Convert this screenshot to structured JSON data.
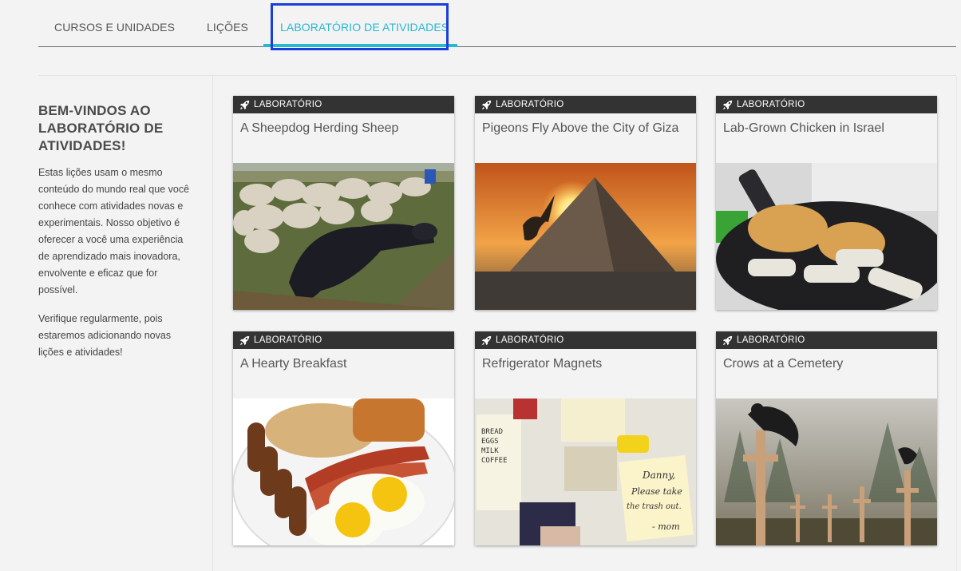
{
  "tabs": [
    {
      "label": "CURSOS E UNIDADES"
    },
    {
      "label": "LIÇÕES"
    },
    {
      "label": "LABORATÓRIO DE ATIVIDADES"
    }
  ],
  "sidebar": {
    "title": "BEM-VINDOS AO LABORATÓRIO DE ATIVIDADES!",
    "paragraph1": "Estas lições usam o mesmo conteúdo do mundo real que você conhece com atividades novas e experimentais. Nosso objetivo é oferecer a você uma experiência de aprendizado mais inovadora, envolvente e eficaz que for possível.",
    "paragraph2": "Verifique regularmente, pois estaremos adicionando novas lições e atividades!"
  },
  "cards": [
    {
      "badge": "LABORATÓRIO",
      "title": "A Sheepdog Herding Sheep"
    },
    {
      "badge": "LABORATÓRIO",
      "title": "Pigeons Fly Above the City of Giza"
    },
    {
      "badge": "LABORATÓRIO",
      "title": "Lab-Grown Chicken in Israel"
    },
    {
      "badge": "LABORATÓRIO",
      "title": "A Hearty Breakfast"
    },
    {
      "badge": "LABORATÓRIO",
      "title": "Refrigerator Magnets"
    },
    {
      "badge": "LABORATÓRIO",
      "title": "Crows at a Cemetery"
    }
  ],
  "note": {
    "line1": "BREAD",
    "line2": "EGGS",
    "line3": "MILK",
    "line4": "COFFEE",
    "sticky1": "Danny,",
    "sticky2": "Please take",
    "sticky3": "the trash out.",
    "sticky4": "- mom"
  },
  "colors": {
    "accent": "#27b8d3",
    "focus": "#1a3fd8",
    "badge_bg": "#333333"
  }
}
